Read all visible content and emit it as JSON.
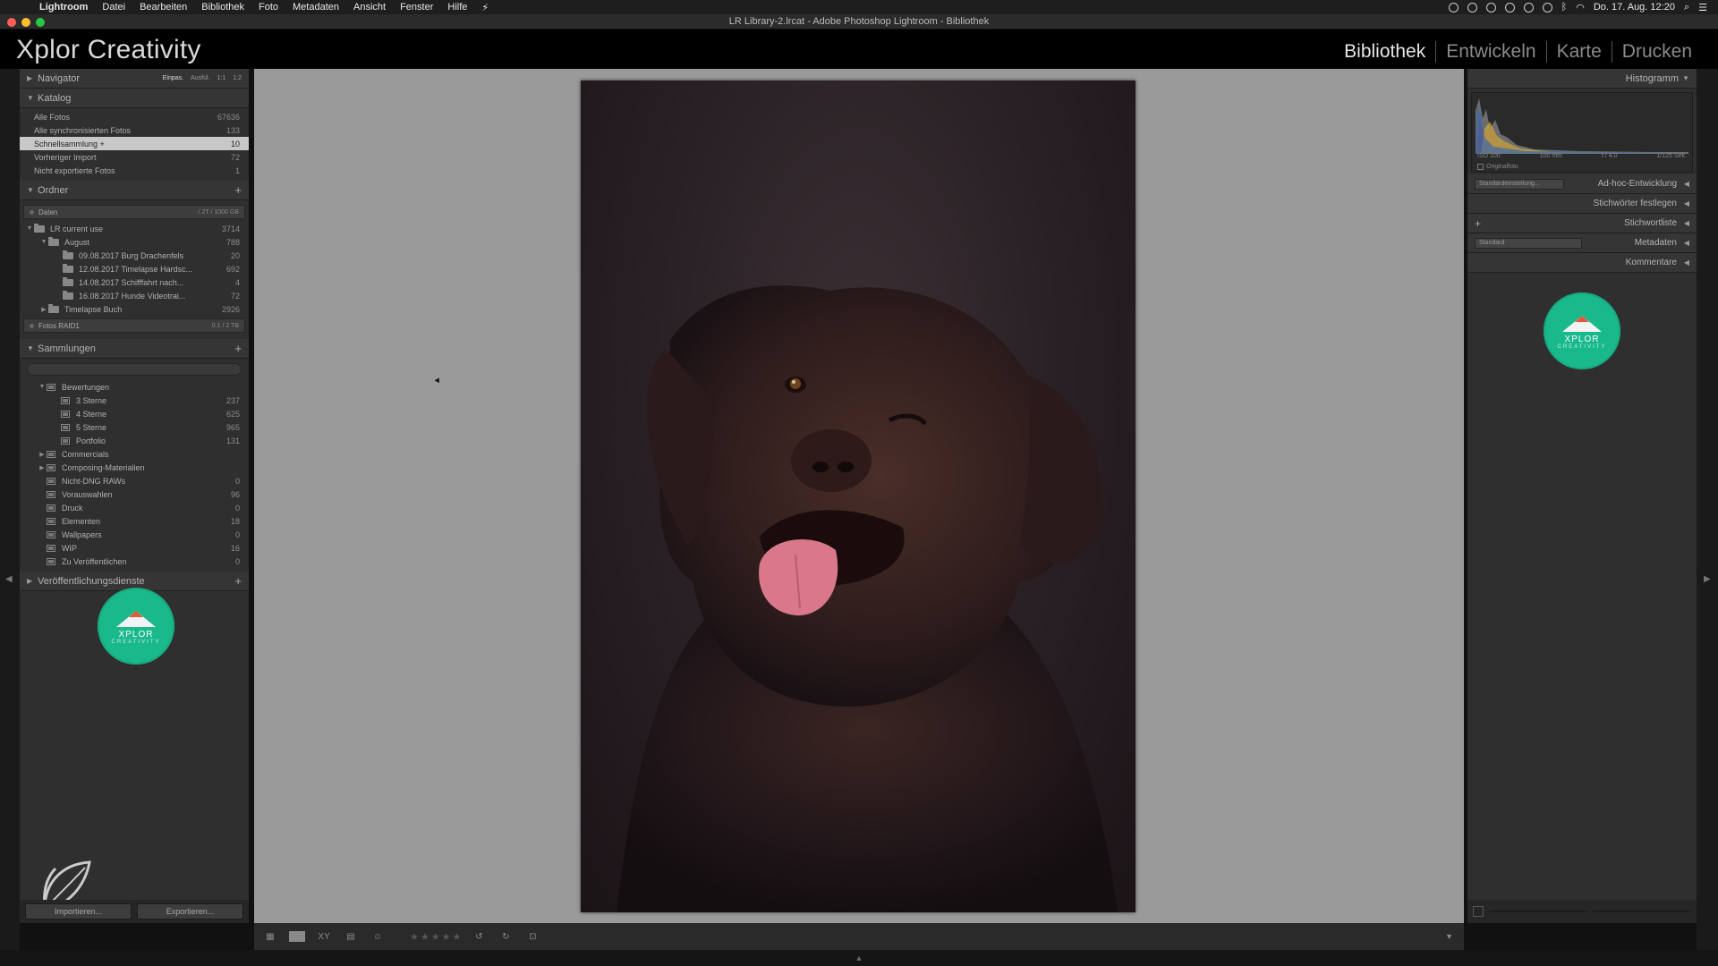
{
  "menubar": {
    "items": [
      "Lightroom",
      "Datei",
      "Bearbeiten",
      "Bibliothek",
      "Foto",
      "Metadaten",
      "Ansicht",
      "Fenster",
      "Hilfe"
    ],
    "clock": "Do. 17. Aug.  12:20"
  },
  "window": {
    "title": "LR Library-2.lrcat - Adobe Photoshop Lightroom - Bibliothek"
  },
  "identity": {
    "brand": "Xplor Creativity"
  },
  "modules": [
    "Bibliothek",
    "Entwickeln",
    "Karte",
    "Drucken"
  ],
  "navigator": {
    "title": "Navigator",
    "options": [
      "Einpas.",
      "Ausfül.",
      "1:1",
      "1:2"
    ]
  },
  "katalog": {
    "title": "Katalog",
    "items": [
      {
        "label": "Alle Fotos",
        "count": "67636"
      },
      {
        "label": "Alle synchronisierten Fotos",
        "count": "133"
      },
      {
        "label": "Schnellsammlung +",
        "count": "10"
      },
      {
        "label": "Vorheriger Import",
        "count": "72"
      },
      {
        "label": "Nicht exportierte Fotos",
        "count": "1"
      }
    ]
  },
  "ordner": {
    "title": "Ordner",
    "volume1": {
      "label": "Daten",
      "info": "/ 2T / 1000 GB"
    },
    "items": [
      {
        "label": "LR current use",
        "count": "3714"
      },
      {
        "label": "August",
        "count": "788"
      },
      {
        "label": "09.08.2017 Burg Drachenfels",
        "count": "20"
      },
      {
        "label": "12.08.2017 Timelapse Hardsc...",
        "count": "692"
      },
      {
        "label": "14.08.2017 Schifffahrt nach...",
        "count": "4"
      },
      {
        "label": "16.08.2017 Hunde Videotrai...",
        "count": "72"
      },
      {
        "label": "Timelapse Buch",
        "count": "2926"
      }
    ],
    "volume2": {
      "label": "Fotos RAID1",
      "info": "0.1 / 2 TB"
    }
  },
  "sammlungen": {
    "title": "Sammlungen",
    "items": [
      {
        "label": "Bewertungen",
        "count": ""
      },
      {
        "label": "3 Sterne",
        "count": "237"
      },
      {
        "label": "4 Sterne",
        "count": "625"
      },
      {
        "label": "5 Sterne",
        "count": "965"
      },
      {
        "label": "Portfolio",
        "count": "131"
      },
      {
        "label": "Commercials",
        "count": ""
      },
      {
        "label": "Composing-Materialien",
        "count": ""
      },
      {
        "label": "Nicht-DNG RAWs",
        "count": "0"
      },
      {
        "label": "Vorauswahlen",
        "count": "96"
      },
      {
        "label": "Druck",
        "count": "0"
      },
      {
        "label": "Elementen",
        "count": "18"
      },
      {
        "label": "Wallpapers",
        "count": "0"
      },
      {
        "label": "WIP",
        "count": "16"
      },
      {
        "label": "Zu Veröffentlichen",
        "count": "0"
      }
    ]
  },
  "veroeffentlichung": {
    "title": "Veröffentlichungsdienste"
  },
  "logo": {
    "line1": "XPLOR",
    "line2": "CREATIVITY",
    "color": "#19b98c"
  },
  "leftbuttons": {
    "import": "Importieren...",
    "export": "Exportieren..."
  },
  "histogram": {
    "title": "Histogramm",
    "iso": "ISO 100",
    "focal": "100 mm",
    "aperture": "f / 4,0",
    "shutter": "1/125 Sek.",
    "original": "Originalfoto"
  },
  "rightpanel": {
    "adhoc": {
      "preset": "Standardeinstellung...",
      "label": "Ad-hoc-Entwicklung"
    },
    "keywords": "Stichwörter festlegen",
    "keywordlist": "Stichwortliste",
    "metadata": {
      "preset": "Standard",
      "label": "Metadaten"
    },
    "comments": "Kommentare"
  },
  "toolbar": {
    "stars": "★★★★★"
  }
}
